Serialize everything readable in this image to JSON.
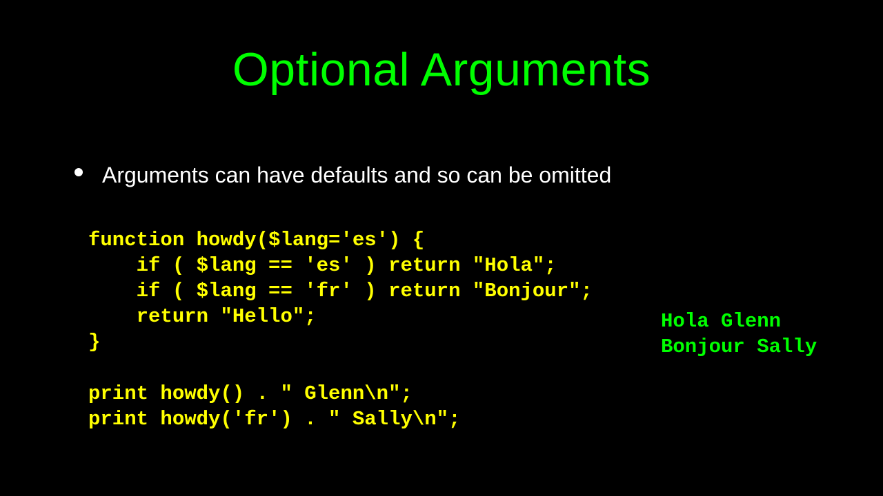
{
  "slide": {
    "title": "Optional Arguments",
    "bullet": "Arguments can have defaults and so can be omitted",
    "code": "function howdy($lang='es') {\n    if ( $lang == 'es' ) return \"Hola\";\n    if ( $lang == 'fr' ) return \"Bonjour\";\n    return \"Hello\";\n}\n\nprint howdy() . \" Glenn\\n\";\nprint howdy('fr') . \" Sally\\n\";",
    "output": "Hola Glenn\nBonjour Sally"
  }
}
